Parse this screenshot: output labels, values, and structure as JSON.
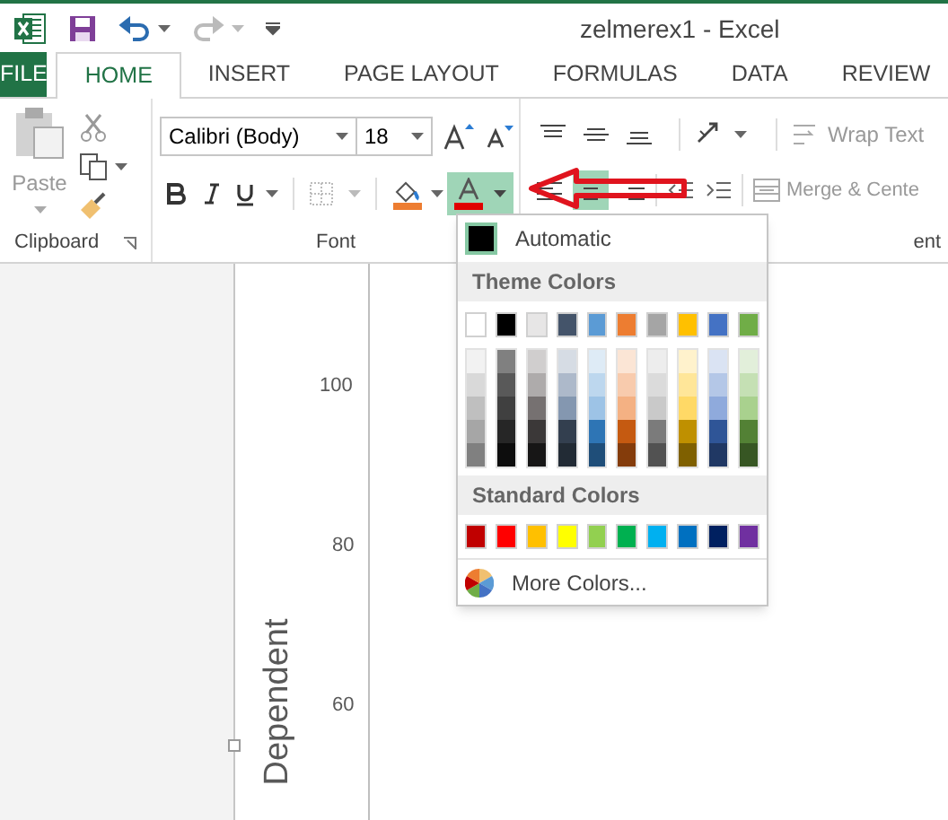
{
  "window": {
    "title": "zelmerex1 - Excel",
    "undo": {
      "disabled": false
    },
    "redo": {
      "disabled": true
    }
  },
  "tabs": [
    {
      "label": "FILE",
      "kind": "file",
      "selected": false
    },
    {
      "label": "HOME",
      "kind": "tab",
      "selected": true
    },
    {
      "label": "INSERT",
      "kind": "tab",
      "selected": false
    },
    {
      "label": "PAGE LAYOUT",
      "kind": "tab",
      "selected": false
    },
    {
      "label": "FORMULAS",
      "kind": "tab",
      "selected": false
    },
    {
      "label": "DATA",
      "kind": "tab",
      "selected": false
    },
    {
      "label": "REVIEW",
      "kind": "tab",
      "selected": false
    }
  ],
  "clipboard": {
    "paste_label": "Paste",
    "group_label": "Clipboard"
  },
  "font": {
    "font_name": "Calibri (Body)",
    "font_size": "18",
    "group_label": "Font",
    "font_color_expanded": true
  },
  "alignment": {
    "group_label": "ent",
    "wrap_text": "Wrap Text",
    "merge": "Merge & Cente"
  },
  "color_menu": {
    "automatic": {
      "label": "Automatic",
      "selected": true
    },
    "theme_heading": "Theme Colors",
    "theme_colors": [
      {
        "color": "#ffffff",
        "shades": [
          {
            "color": "#f2f2f2"
          },
          {
            "color": "#d9d9d9"
          },
          {
            "color": "#bfbfbf"
          },
          {
            "color": "#a6a6a6"
          },
          {
            "color": "#808080"
          }
        ]
      },
      {
        "color": "#000000",
        "shades": [
          {
            "color": "#808080"
          },
          {
            "color": "#595959"
          },
          {
            "color": "#404040"
          },
          {
            "color": "#262626"
          },
          {
            "color": "#0d0d0d"
          }
        ]
      },
      {
        "color": "#e7e6e6",
        "shades": [
          {
            "color": "#d0cece"
          },
          {
            "color": "#aeabab"
          },
          {
            "color": "#767171"
          },
          {
            "color": "#3b3838"
          },
          {
            "color": "#171616"
          }
        ]
      },
      {
        "color": "#44546a",
        "shades": [
          {
            "color": "#d6dce4"
          },
          {
            "color": "#adb9ca"
          },
          {
            "color": "#8497b0"
          },
          {
            "color": "#333f4f"
          },
          {
            "color": "#222b35"
          }
        ]
      },
      {
        "color": "#5b9bd5",
        "shades": [
          {
            "color": "#deebf6"
          },
          {
            "color": "#bdd7ee"
          },
          {
            "color": "#9dc3e6"
          },
          {
            "color": "#2e75b5"
          },
          {
            "color": "#1f4e79"
          }
        ]
      },
      {
        "color": "#ed7d31",
        "shades": [
          {
            "color": "#fbe5d5"
          },
          {
            "color": "#f8cbad"
          },
          {
            "color": "#f4b183"
          },
          {
            "color": "#c55a11"
          },
          {
            "color": "#843c0b"
          }
        ]
      },
      {
        "color": "#a5a5a5",
        "shades": [
          {
            "color": "#ededed"
          },
          {
            "color": "#dbdbdb"
          },
          {
            "color": "#c9c9c9"
          },
          {
            "color": "#7b7b7b"
          },
          {
            "color": "#525252"
          }
        ]
      },
      {
        "color": "#ffc000",
        "shades": [
          {
            "color": "#fff2cc"
          },
          {
            "color": "#ffe699"
          },
          {
            "color": "#ffd966"
          },
          {
            "color": "#bf9000"
          },
          {
            "color": "#7f6000"
          }
        ]
      },
      {
        "color": "#4472c4",
        "shades": [
          {
            "color": "#dae3f3"
          },
          {
            "color": "#b4c7e7"
          },
          {
            "color": "#8faadc"
          },
          {
            "color": "#2f5597"
          },
          {
            "color": "#203864"
          }
        ]
      },
      {
        "color": "#70ad47",
        "shades": [
          {
            "color": "#e2efda"
          },
          {
            "color": "#c5e0b4"
          },
          {
            "color": "#a9d18e"
          },
          {
            "color": "#538135"
          },
          {
            "color": "#375623"
          }
        ]
      }
    ],
    "standard_heading": "Standard Colors",
    "standard_colors": [
      {
        "color": "#c00000"
      },
      {
        "color": "#ff0000"
      },
      {
        "color": "#ffc000"
      },
      {
        "color": "#ffff00"
      },
      {
        "color": "#92d050"
      },
      {
        "color": "#00b050"
      },
      {
        "color": "#00b0f0"
      },
      {
        "color": "#0070c0"
      },
      {
        "color": "#002060"
      },
      {
        "color": "#7030a0"
      }
    ],
    "more_colors": "More Colors..."
  },
  "chart": {
    "axis_title": "Dependent",
    "tick_labels": [
      "100",
      "80",
      "60"
    ]
  }
}
